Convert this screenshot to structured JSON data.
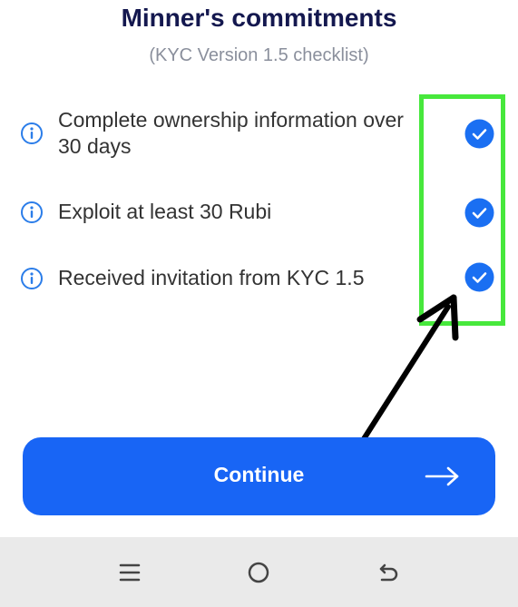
{
  "header": {
    "title": "Minner's commitments",
    "subtitle": "(KYC Version 1.5 checklist)"
  },
  "checklist": [
    {
      "icon": "info-icon",
      "label_line1": "Complete ownership information over",
      "label_line2": "30 days",
      "checked": true
    },
    {
      "icon": "info-icon",
      "label_line1": "Exploit at least 30 Rubi",
      "checked": true
    },
    {
      "icon": "info-icon",
      "label_line1": "Received invitation from KYC 1.5",
      "checked": true
    }
  ],
  "continue_button": {
    "label": "Continue",
    "icon": "arrow-right-icon"
  },
  "nav_bar": {
    "menu_icon": "menu-icon",
    "home_icon": "home-icon",
    "back_icon": "back-icon"
  },
  "colors": {
    "title": "#14184f",
    "subtitle": "#8a8f9c",
    "accent": "#1865f5",
    "check": "#1a6ff2",
    "highlight": "#47e83c",
    "navbar": "#eaeaea"
  }
}
